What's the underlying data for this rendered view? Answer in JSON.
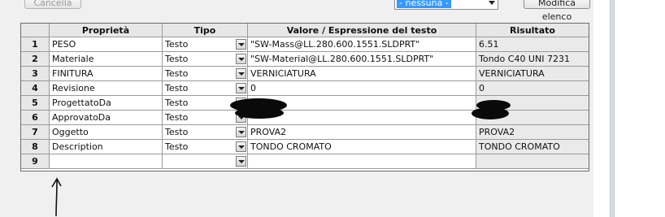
{
  "toolbar": {
    "cancel_label": "Cancella",
    "config_select_value": "- nessuna -",
    "edit_list_label": "Modifica elenco"
  },
  "table": {
    "columns": [
      "",
      "Proprietà",
      "Tipo",
      "Valore / Espressione del testo",
      "Risultato"
    ],
    "rows": [
      {
        "num": "1",
        "name": "PESO",
        "type": "Testo",
        "value": "\"SW-Mass@LL.280.600.1551.SLDPRT\"",
        "result": "6.51"
      },
      {
        "num": "2",
        "name": "Materiale",
        "type": "Testo",
        "value": "\"SW-Material@LL.280.600.1551.SLDPRT\"",
        "result": "Tondo C40 UNI 7231"
      },
      {
        "num": "3",
        "name": "FINITURA",
        "type": "Testo",
        "value": "VERNICIATURA",
        "result": "VERNICIATURA"
      },
      {
        "num": "4",
        "name": "Revisione",
        "type": "Testo",
        "value": "0",
        "result": "0"
      },
      {
        "num": "5",
        "name": "ProgettatoDa",
        "type": "Testo",
        "value": "",
        "result": ""
      },
      {
        "num": "6",
        "name": "ApprovatoDa",
        "type": "Testo",
        "value": "",
        "result": ""
      },
      {
        "num": "7",
        "name": "Oggetto",
        "type": "Testo",
        "value": "PROVA2",
        "result": "PROVA2"
      },
      {
        "num": "8",
        "name": "Description",
        "type": "Testo",
        "value": "TONDO CROMATO",
        "result": "TONDO CROMATO"
      },
      {
        "num": "9",
        "name": "",
        "type": "",
        "value": "",
        "result": ""
      }
    ]
  },
  "icons": {
    "dropdown": "chevron-down-icon",
    "annotation": "hand-drawn-arrow-up"
  },
  "colors": {
    "selection": "#3399ff",
    "redaction": "#0a0a0a"
  }
}
